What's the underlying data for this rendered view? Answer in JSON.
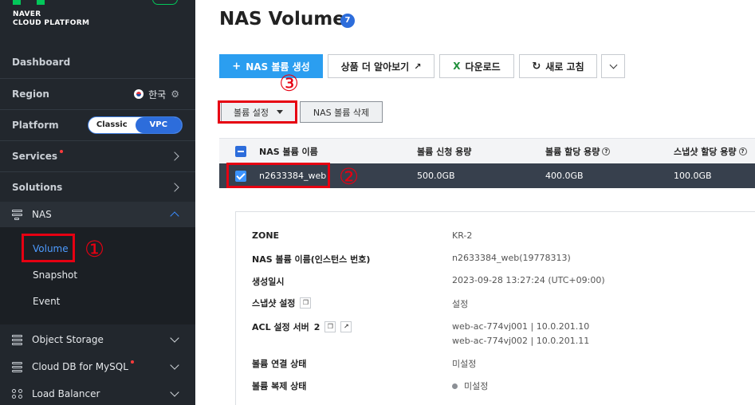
{
  "brand": {
    "line1": "NAVER",
    "line2": "CLOUD PLATFORM",
    "badge": ""
  },
  "sidebar": {
    "dashboard": "Dashboard",
    "region_label": "Region",
    "region_value": "한국",
    "platform_label": "Platform",
    "platform_options": [
      "Classic",
      "VPC"
    ],
    "platform_selected": "VPC",
    "services": "Services",
    "solutions": "Solutions",
    "nas": "NAS",
    "nas_items": [
      "Volume",
      "Snapshot",
      "Event"
    ],
    "nas_selected": "Volume",
    "bottom_items": [
      "Object Storage",
      "Cloud DB for MySQL",
      "Load Balancer"
    ]
  },
  "page": {
    "title": "NAS Volume",
    "count": "7"
  },
  "toolbar": {
    "create": "NAS 볼륨 생성",
    "learn_more": "상품 더 알아보기",
    "download": "다운로드",
    "refresh": "새로 고침"
  },
  "actions": {
    "volume_settings": "볼륨 설정",
    "delete": "NAS 볼륨 삭제"
  },
  "table": {
    "headers": [
      "NAS 볼륨 이름",
      "볼륨 신청 용량",
      "볼륨 할당 용량",
      "스냅샷 할당 용량"
    ],
    "rows": [
      {
        "name": "n2633384_web",
        "requested": "500.0GB",
        "allocated": "400.0GB",
        "snapshot": "100.0GB"
      }
    ]
  },
  "detail": {
    "zone_label": "ZONE",
    "zone_value": "KR-2",
    "name_label": "NAS 볼륨 이름(인스턴스 번호)",
    "name_value": "n2633384_web(19778313)",
    "created_label": "생성일시",
    "created_value": "2023-09-28 13:27:24 (UTC+09:00)",
    "snapshot_label": "스냅샷 설정",
    "snapshot_value": "설정",
    "acl_label": "ACL 설정 서버",
    "acl_count": "2",
    "acl_values": [
      "web-ac-774vj001 | 10.0.201.10",
      "web-ac-774vj002 | 10.0.201.11"
    ],
    "mount_label": "볼륨 연결 상태",
    "mount_value": "미설정",
    "replica_label": "볼륨 복제 상태",
    "replica_value": "미설정"
  },
  "annotations": [
    "①",
    "②",
    "③"
  ],
  "colors": {
    "accent": "#2b9ef0",
    "annotation": "#e60012",
    "sidebar_bg": "#22272d",
    "selected_row": "#37404d"
  }
}
